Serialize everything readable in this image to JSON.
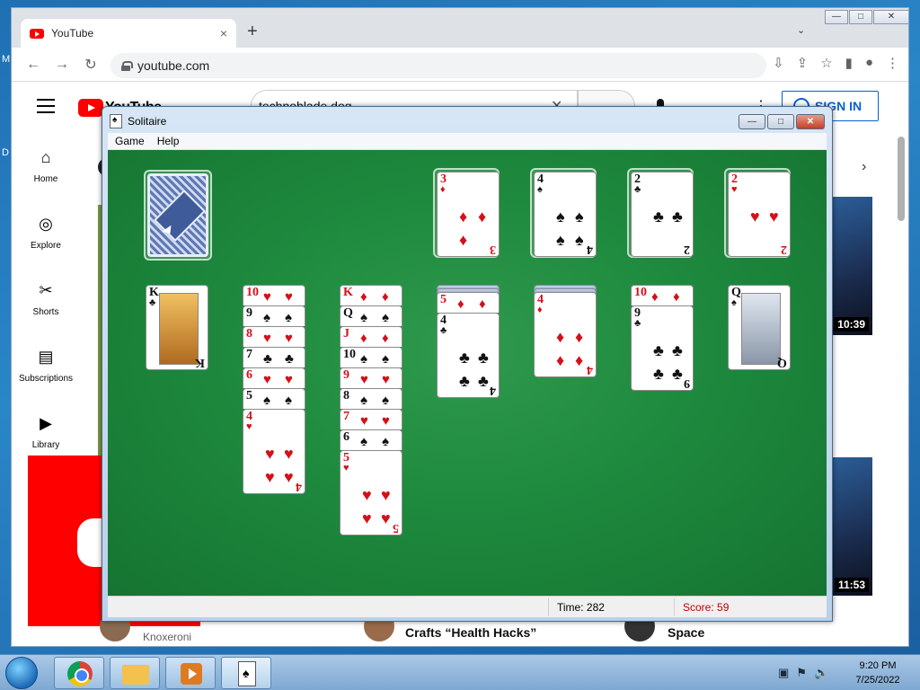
{
  "desktop": {
    "label_m": "M",
    "label_d": "D"
  },
  "browser": {
    "tab_title": "YouTube",
    "tab_close": "×",
    "new_tab": "+",
    "tab_list": "⌄",
    "controls": [
      "—",
      "□",
      "✕"
    ],
    "nav": {
      "back": "←",
      "forward": "→",
      "reload": "↻"
    },
    "url": "youtube.com",
    "toolbar_icons": [
      "⇩",
      "⇪",
      "☆",
      "▮",
      "●",
      "⋮"
    ]
  },
  "youtube": {
    "logo_text": "YouTube",
    "search_value": "technoblade dog",
    "search_clear": "✕",
    "sign_in": "SIGN IN",
    "more": "⋮",
    "chevron": "›",
    "sidebar": [
      {
        "icon": "⌂",
        "label": "Home"
      },
      {
        "icon": "◎",
        "label": "Explore"
      },
      {
        "icon": "✂",
        "label": "Shorts"
      },
      {
        "icon": "▤",
        "label": "Subscriptions"
      },
      {
        "icon": "▶",
        "label": "Library"
      }
    ],
    "durations": [
      "10:39",
      "11:53"
    ],
    "bottom": {
      "channel": "Knoxeroni",
      "video_title": "Crafts “Health Hacks”",
      "title_right": "Space"
    }
  },
  "solitaire": {
    "title": "Solitaire",
    "controls": [
      "—",
      "□",
      "✕"
    ],
    "menu": [
      "Game",
      "Help"
    ],
    "status": {
      "time_label": "Time:",
      "time_value": "282",
      "score_label": "Score:",
      "score_value": "59"
    },
    "foundations": [
      {
        "rank": "3",
        "suit": "♦",
        "color": "red"
      },
      {
        "rank": "4",
        "suit": "♠",
        "color": "black"
      },
      {
        "rank": "2",
        "suit": "♣",
        "color": "black"
      },
      {
        "rank": "2",
        "suit": "♥",
        "color": "red"
      }
    ],
    "tableau": [
      {
        "hidden": 0,
        "cards": [
          {
            "rank": "K",
            "suit": "♣",
            "color": "black"
          }
        ]
      },
      {
        "hidden": 0,
        "cards": [
          {
            "rank": "10",
            "suit": "♥",
            "color": "red"
          },
          {
            "rank": "9",
            "suit": "♠",
            "color": "black"
          },
          {
            "rank": "8",
            "suit": "♥",
            "color": "red"
          },
          {
            "rank": "7",
            "suit": "♣",
            "color": "black"
          },
          {
            "rank": "6",
            "suit": "♥",
            "color": "red"
          },
          {
            "rank": "5",
            "suit": "♠",
            "color": "black"
          },
          {
            "rank": "4",
            "suit": "♥",
            "color": "red"
          }
        ]
      },
      {
        "hidden": 0,
        "cards": [
          {
            "rank": "K",
            "suit": "♦",
            "color": "red"
          },
          {
            "rank": "Q",
            "suit": "♠",
            "color": "black"
          },
          {
            "rank": "J",
            "suit": "♦",
            "color": "red"
          },
          {
            "rank": "10",
            "suit": "♠",
            "color": "black"
          },
          {
            "rank": "9",
            "suit": "♥",
            "color": "red"
          },
          {
            "rank": "8",
            "suit": "♠",
            "color": "black"
          },
          {
            "rank": "7",
            "suit": "♥",
            "color": "red"
          },
          {
            "rank": "6",
            "suit": "♠",
            "color": "black"
          },
          {
            "rank": "5",
            "suit": "♥",
            "color": "red"
          }
        ]
      },
      {
        "hidden": 2,
        "cards": [
          {
            "rank": "5",
            "suit": "♦",
            "color": "red"
          },
          {
            "rank": "4",
            "suit": "♣",
            "color": "black"
          }
        ]
      },
      {
        "hidden": 2,
        "cards": [
          {
            "rank": "4",
            "suit": "♦",
            "color": "red"
          }
        ]
      },
      {
        "hidden": 0,
        "cards": [
          {
            "rank": "10",
            "suit": "♦",
            "color": "red"
          },
          {
            "rank": "9",
            "suit": "♣",
            "color": "black"
          }
        ]
      },
      {
        "hidden": 0,
        "cards": [
          {
            "rank": "Q",
            "suit": "♠",
            "color": "black"
          }
        ]
      }
    ]
  },
  "taskbar": {
    "clock_time": "9:20 PM",
    "clock_date": "7/25/2022",
    "tray_icons": [
      "▣",
      "⚑",
      "🔈"
    ]
  }
}
